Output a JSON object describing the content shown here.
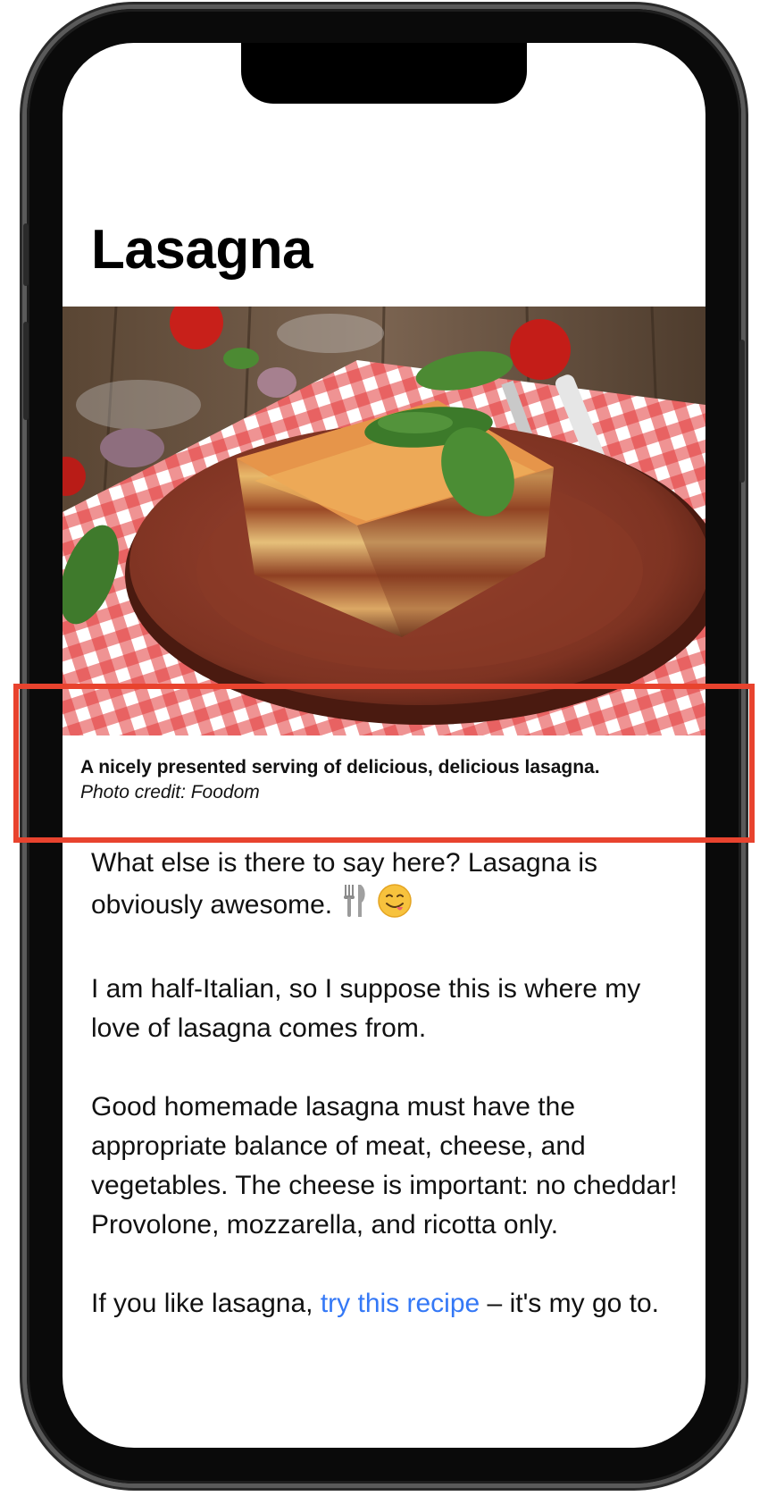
{
  "article": {
    "title": "Lasagna",
    "image": {
      "icon": "lasagna-photo"
    },
    "caption": {
      "main": "A nicely presented serving of delicious, delicious lasagna.",
      "credit": "Photo credit: Foodom"
    },
    "paragraphs": {
      "p1": "What else is there to say here? Lasagna is obviously awesome.",
      "p1_emojis": [
        "fork-and-knife-icon",
        "yum-face-icon"
      ],
      "p2": "I am half-Italian, so I suppose this is where my love of lasagna comes from.",
      "p3": "Good homemade lasagna must have the appropriate balance of meat, cheese, and vegetables. The cheese is important: no cheddar! Provolone, mozzarella, and ricotta only.",
      "p4_before": "If you like lasagna, ",
      "p4_link": "try this recipe",
      "p4_after": " – it's my go to."
    }
  },
  "colors": {
    "link": "#3478f6",
    "highlight": "#e8432e",
    "frame": "#0a0a0a"
  }
}
